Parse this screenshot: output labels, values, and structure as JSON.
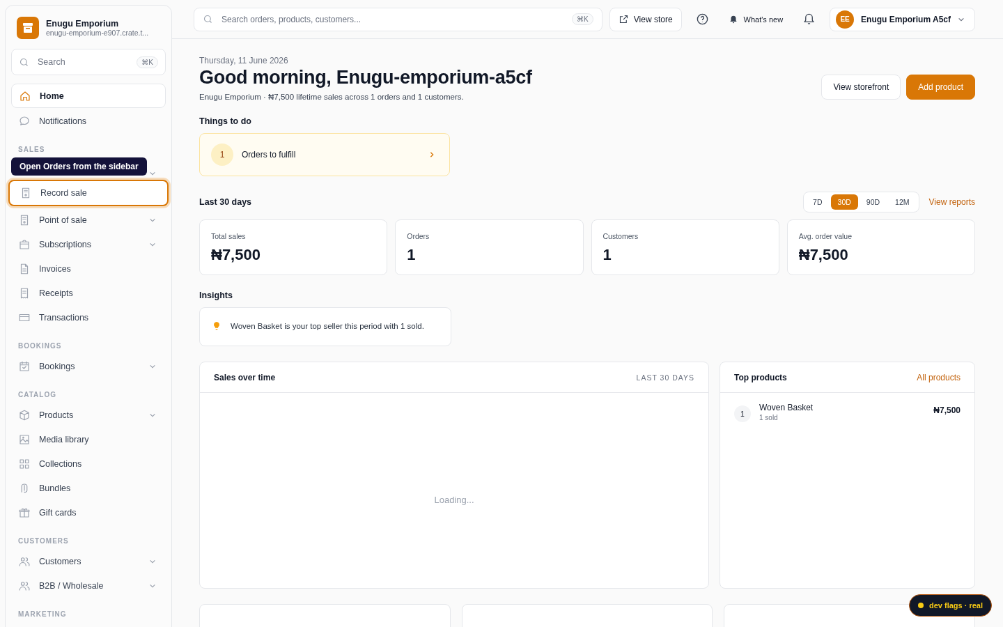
{
  "sidebar": {
    "store": {
      "name": "Enugu Emporium",
      "url": "enugu-emporium-e907.crate.t..."
    },
    "search": {
      "placeholder": "Search",
      "shortcut": "⌘K"
    },
    "sections": [
      {
        "items": [
          {
            "label": "Home",
            "selected": true,
            "highlighted": false,
            "expandable": false
          },
          {
            "label": "Notifications",
            "selected": false,
            "highlighted": false,
            "expandable": false
          }
        ]
      },
      {
        "heading": "SALES",
        "tooltip": "Open Orders from the sidebar",
        "items": [
          {
            "label": "Record sale",
            "selected": false,
            "highlighted": true,
            "expandable": false
          },
          {
            "label": "Point of sale",
            "selected": false,
            "highlighted": false,
            "expandable": true
          },
          {
            "label": "Subscriptions",
            "selected": false,
            "highlighted": false,
            "expandable": true
          },
          {
            "label": "Invoices",
            "selected": false,
            "highlighted": false,
            "expandable": false
          },
          {
            "label": "Receipts",
            "selected": false,
            "highlighted": false,
            "expandable": false
          },
          {
            "label": "Transactions",
            "selected": false,
            "highlighted": false,
            "expandable": false
          }
        ]
      },
      {
        "heading": "BOOKINGS",
        "items": [
          {
            "label": "Bookings",
            "selected": false,
            "highlighted": false,
            "expandable": true
          }
        ]
      },
      {
        "heading": "CATALOG",
        "items": [
          {
            "label": "Products",
            "selected": false,
            "highlighted": false,
            "expandable": true
          },
          {
            "label": "Media library",
            "selected": false,
            "highlighted": false,
            "expandable": false
          },
          {
            "label": "Collections",
            "selected": false,
            "highlighted": false,
            "expandable": false
          },
          {
            "label": "Bundles",
            "selected": false,
            "highlighted": false,
            "expandable": false
          },
          {
            "label": "Gift cards",
            "selected": false,
            "highlighted": false,
            "expandable": false
          }
        ]
      },
      {
        "heading": "CUSTOMERS",
        "items": [
          {
            "label": "Customers",
            "selected": false,
            "highlighted": false,
            "expandable": true
          },
          {
            "label": "B2B / Wholesale",
            "selected": false,
            "highlighted": false,
            "expandable": true
          }
        ]
      },
      {
        "heading": "MARKETING"
      }
    ]
  },
  "topbar": {
    "search": {
      "placeholder": "Search orders, products, customers...",
      "shortcut": "⌘K"
    },
    "view_store": "View store",
    "whats_new": "What's new",
    "account": {
      "initials": "EE",
      "name": "Enugu Emporium A5cf"
    }
  },
  "header": {
    "date": "Thursday, 11 June 2026",
    "greeting": "Good morning, Enugu-emporium-a5cf",
    "summary": "Enugu Emporium · ₦7,500 lifetime sales across 1 orders and 1 customers.",
    "buttons": [
      {
        "label": "View storefront",
        "kind": "secondary"
      },
      {
        "label": "Add product",
        "kind": "primary"
      }
    ]
  },
  "todo": {
    "title": "Things to do",
    "items": [
      {
        "count": "1",
        "label": "Orders to fulfill"
      }
    ]
  },
  "period": {
    "title": "Last 30 days",
    "ranges": [
      {
        "label": "7D",
        "selected": false
      },
      {
        "label": "30D",
        "selected": true
      },
      {
        "label": "90D",
        "selected": false
      },
      {
        "label": "12M",
        "selected": false
      }
    ],
    "link": "View reports"
  },
  "stats": [
    {
      "label": "Total sales",
      "value": "₦7,500"
    },
    {
      "label": "Orders",
      "value": "1"
    },
    {
      "label": "Customers",
      "value": "1"
    },
    {
      "label": "Avg. order value",
      "value": "₦7,500"
    }
  ],
  "insights": {
    "title": "Insights",
    "items": [
      "Woven Basket is your top seller this period with 1 sold."
    ]
  },
  "sales_chart": {
    "title": "Sales over time",
    "range": "LAST 30 DAYS",
    "status": "Loading..."
  },
  "top_products": {
    "title": "Top products",
    "link": "All products",
    "items": [
      {
        "rank": "1",
        "name": "Woven Basket",
        "sold": "1 sold",
        "amount": "₦7,500"
      }
    ]
  },
  "dev_badge": "dev flags · real"
}
